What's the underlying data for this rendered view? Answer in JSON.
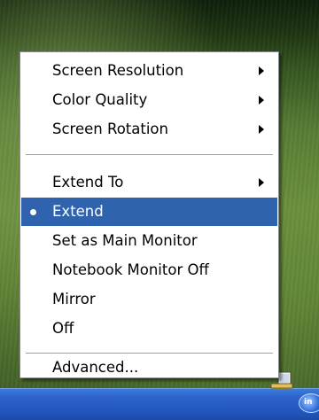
{
  "menu": {
    "groups": [
      [
        {
          "label": "Screen Resolution",
          "submenu": true
        },
        {
          "label": "Color Quality",
          "submenu": true
        },
        {
          "label": "Screen Rotation",
          "submenu": true
        }
      ],
      [
        {
          "label": "Extend To",
          "submenu": true
        },
        {
          "label": "Extend",
          "selected": true,
          "checked": "bullet"
        },
        {
          "label": "Set as Main Monitor"
        },
        {
          "label": "Notebook Monitor Off"
        },
        {
          "label": "Mirror"
        },
        {
          "label": "Off"
        }
      ],
      [
        {
          "label": "Advanced..."
        }
      ]
    ]
  },
  "tray": {
    "icons": [
      "monitor-icon",
      "intel-graphics-icon"
    ]
  },
  "colors": {
    "highlight": "#2f63ad",
    "menu_background": "#ffffff",
    "taskbar": "#2a61c8"
  }
}
